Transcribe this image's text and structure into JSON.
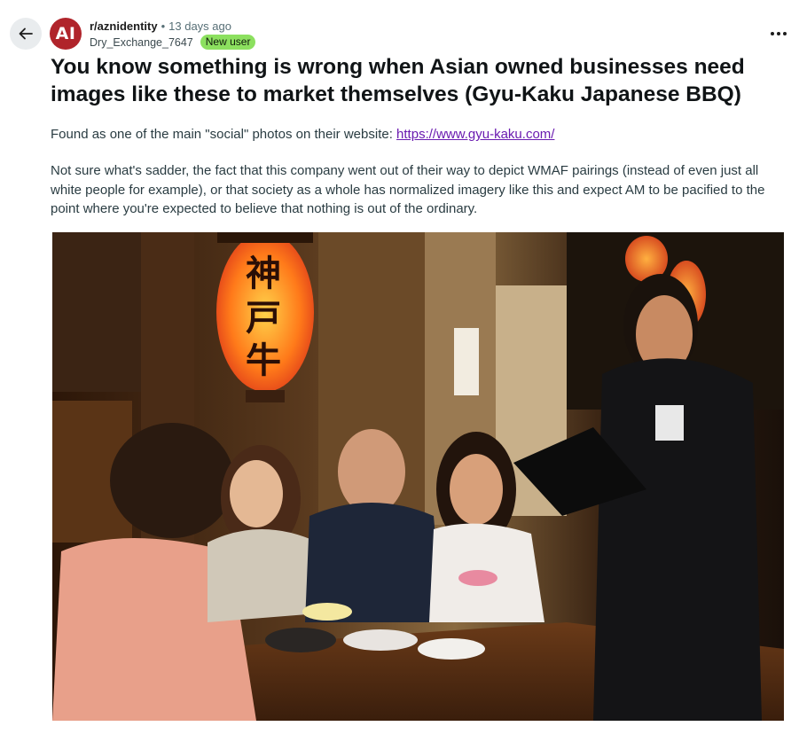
{
  "header": {
    "back_icon": "arrow-left-icon",
    "avatar_text": "AI",
    "subreddit": "r/aznidentity",
    "separator": "•",
    "time_ago": "13 days ago",
    "author": "Dry_Exchange_7647",
    "flair": "New user",
    "more_icon": "ellipsis-icon"
  },
  "post": {
    "title": "You know something is wrong when Asian owned businesses need images like these to market themselves (Gyu-Kaku Japanese BBQ)",
    "p1_prefix": "Found as one of the main \"social\" photos on their website: ",
    "p1_link": "https://www.gyu-kaku.com/",
    "p2": "Not sure what's sadder, the fact that this company went out of their way to depict WMAF pairings (instead of even just all white people for example), or that society as a whole has normalized imagery like this and expect AM to be pacified to the point where you're expected to believe that nothing is out of the ordinary."
  },
  "colors": {
    "accent_avatar": "#b0242b",
    "flair_bg": "#8ce05f",
    "link": "#6a1bb0"
  }
}
